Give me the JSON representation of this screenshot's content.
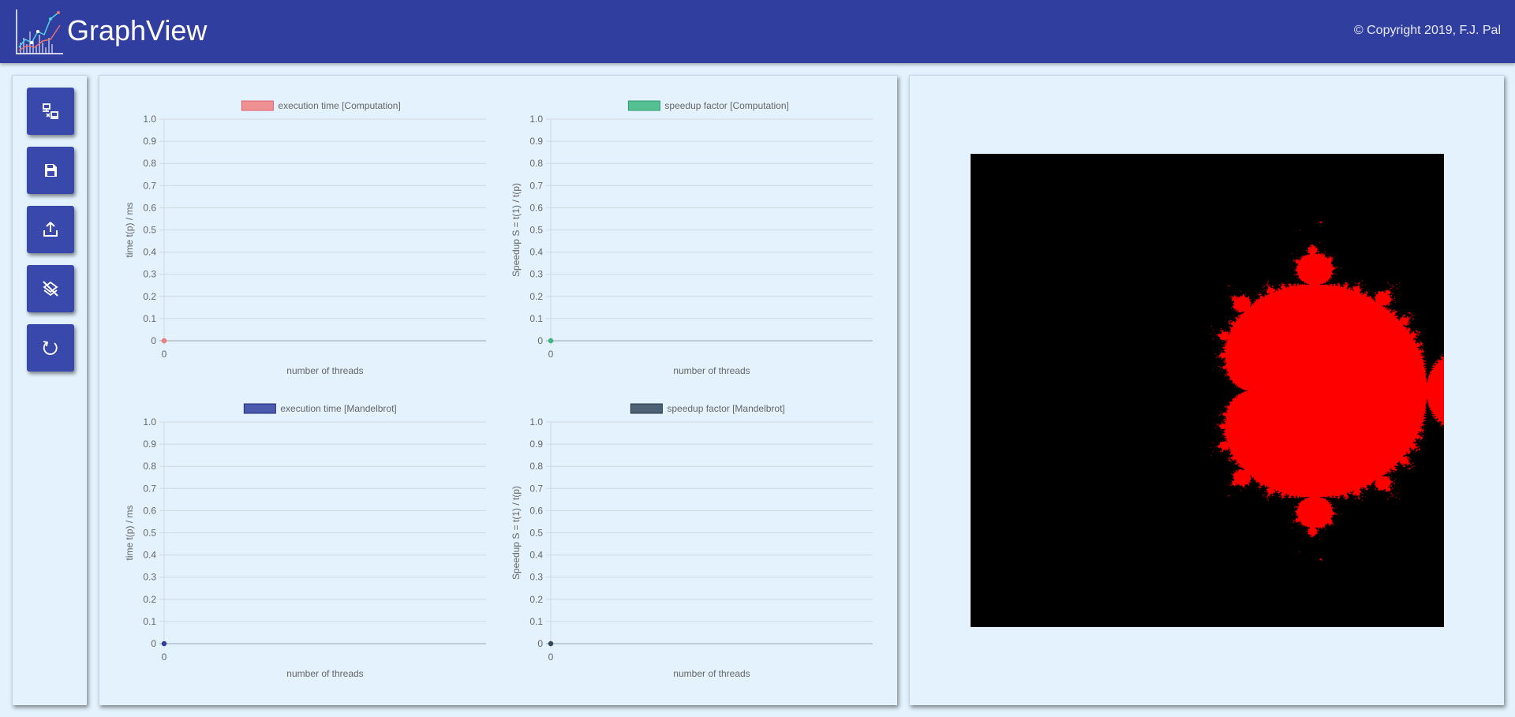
{
  "header": {
    "title": "GraphView",
    "copyright": "© Copyright 2019, F.J. Pal",
    "background": "#303f9f"
  },
  "toolbar": {
    "buttons": [
      {
        "name": "connect-button",
        "icon": "network-connect-icon"
      },
      {
        "name": "save-button",
        "icon": "floppy-disk-icon"
      },
      {
        "name": "export-button",
        "icon": "upload-icon"
      },
      {
        "name": "clear-button",
        "icon": "layers-off-icon"
      },
      {
        "name": "reload-button",
        "icon": "refresh-icon"
      }
    ],
    "button_color": "#3949ab"
  },
  "chart_data": [
    {
      "type": "line",
      "legend": "execution time [Computation]",
      "color": "#f08080",
      "legend_border": "#e06070",
      "ylabel": "time  t(p)  /  ms",
      "xlabel": "number of threads",
      "x": [
        0
      ],
      "y": [
        0
      ],
      "ylim": [
        0,
        1.0
      ],
      "yticks": [
        "0",
        "0.1",
        "0.2",
        "0.3",
        "0.4",
        "0.5",
        "0.6",
        "0.7",
        "0.8",
        "0.9",
        "1.0"
      ],
      "xticks": [
        "0"
      ],
      "grid": true,
      "legend_position": "top"
    },
    {
      "type": "line",
      "legend": "speedup factor [Computation]",
      "color": "#3cb880",
      "legend_border": "#2e9c6a",
      "ylabel": "Speedup  S  =  t(1)  /  t(p)",
      "xlabel": "number of threads",
      "x": [
        0
      ],
      "y": [
        0
      ],
      "ylim": [
        0,
        1.0
      ],
      "yticks": [
        "0",
        "0.1",
        "0.2",
        "0.3",
        "0.4",
        "0.5",
        "0.6",
        "0.7",
        "0.8",
        "0.9",
        "1.0"
      ],
      "xticks": [
        "0"
      ],
      "grid": true,
      "legend_position": "top"
    },
    {
      "type": "line",
      "legend": "execution time [Mandelbrot]",
      "color": "#303f9f",
      "legend_border": "#1f2b7a",
      "ylabel": "time  t(p)  /  ms",
      "xlabel": "number of threads",
      "x": [
        0
      ],
      "y": [
        0
      ],
      "ylim": [
        0,
        1.0
      ],
      "yticks": [
        "0",
        "0.1",
        "0.2",
        "0.3",
        "0.4",
        "0.5",
        "0.6",
        "0.7",
        "0.8",
        "0.9",
        "1.0"
      ],
      "xticks": [
        "0"
      ],
      "grid": true,
      "legend_position": "top"
    },
    {
      "type": "line",
      "legend": "speedup factor [Mandelbrot]",
      "color": "#34495e",
      "legend_border": "#263646",
      "ylabel": "Speedup  S  =  t(1)  /  t(p)",
      "xlabel": "number of threads",
      "x": [
        0
      ],
      "y": [
        0
      ],
      "ylim": [
        0,
        1.0
      ],
      "yticks": [
        "0",
        "0.1",
        "0.2",
        "0.3",
        "0.4",
        "0.5",
        "0.6",
        "0.7",
        "0.8",
        "0.9",
        "1.0"
      ],
      "xticks": [
        "0"
      ],
      "grid": true,
      "legend_position": "top"
    }
  ],
  "fractal": {
    "name": "mandelbrot-set",
    "set_color": "#ff0000",
    "background": "#000000"
  }
}
